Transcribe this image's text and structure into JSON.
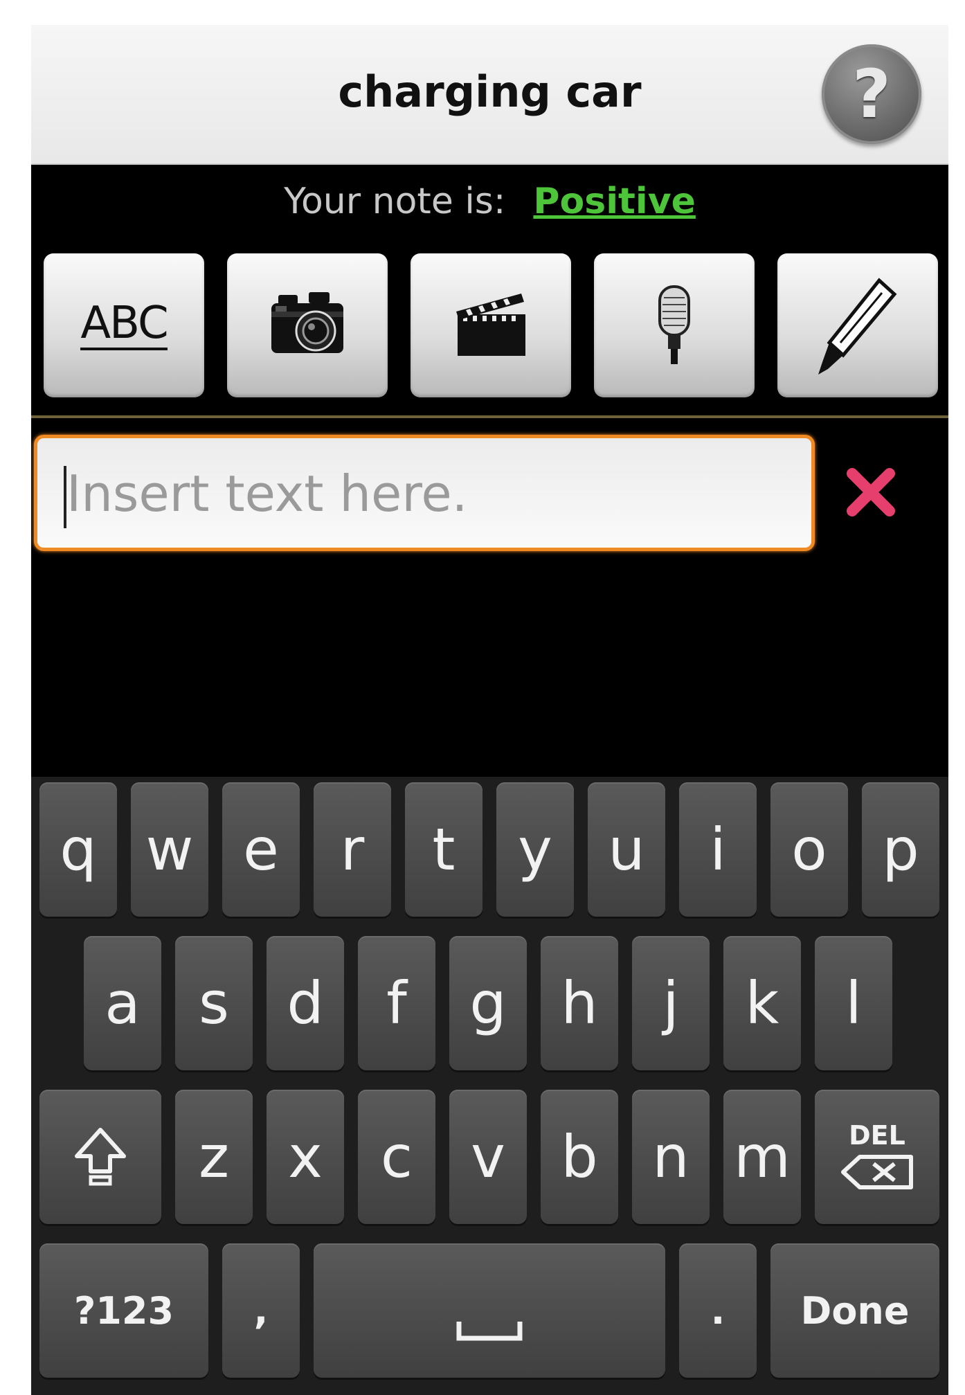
{
  "app": {
    "title": "charging car",
    "help_icon": "question-mark-icon"
  },
  "note": {
    "label": "Your note is:",
    "value": "Positive",
    "value_color": "#4ec43a"
  },
  "media_buttons": [
    {
      "name": "text",
      "label": "ABC",
      "icon": "text-abc-icon"
    },
    {
      "name": "photo",
      "icon": "camera-icon"
    },
    {
      "name": "video",
      "icon": "clapperboard-icon"
    },
    {
      "name": "audio",
      "icon": "microphone-icon"
    },
    {
      "name": "draw",
      "icon": "crayon-icon"
    }
  ],
  "text_field": {
    "placeholder": "Insert text here.",
    "value": "",
    "focus_color": "#f08a24"
  },
  "clear_button": {
    "icon": "close-icon",
    "color": "#e63e6d"
  },
  "keyboard": {
    "row1": [
      "q",
      "w",
      "e",
      "r",
      "t",
      "y",
      "u",
      "i",
      "o",
      "p"
    ],
    "row2": [
      "a",
      "s",
      "d",
      "f",
      "g",
      "h",
      "j",
      "k",
      "l"
    ],
    "row3": [
      "z",
      "x",
      "c",
      "v",
      "b",
      "n",
      "m"
    ],
    "shift_icon": "shift-arrow-icon",
    "delete_label": "DEL",
    "delete_icon": "backspace-icon",
    "symbols_label": "?123",
    "comma_label": ",",
    "space_icon": "space-bar-icon",
    "period_label": ".",
    "done_label": "Done"
  }
}
